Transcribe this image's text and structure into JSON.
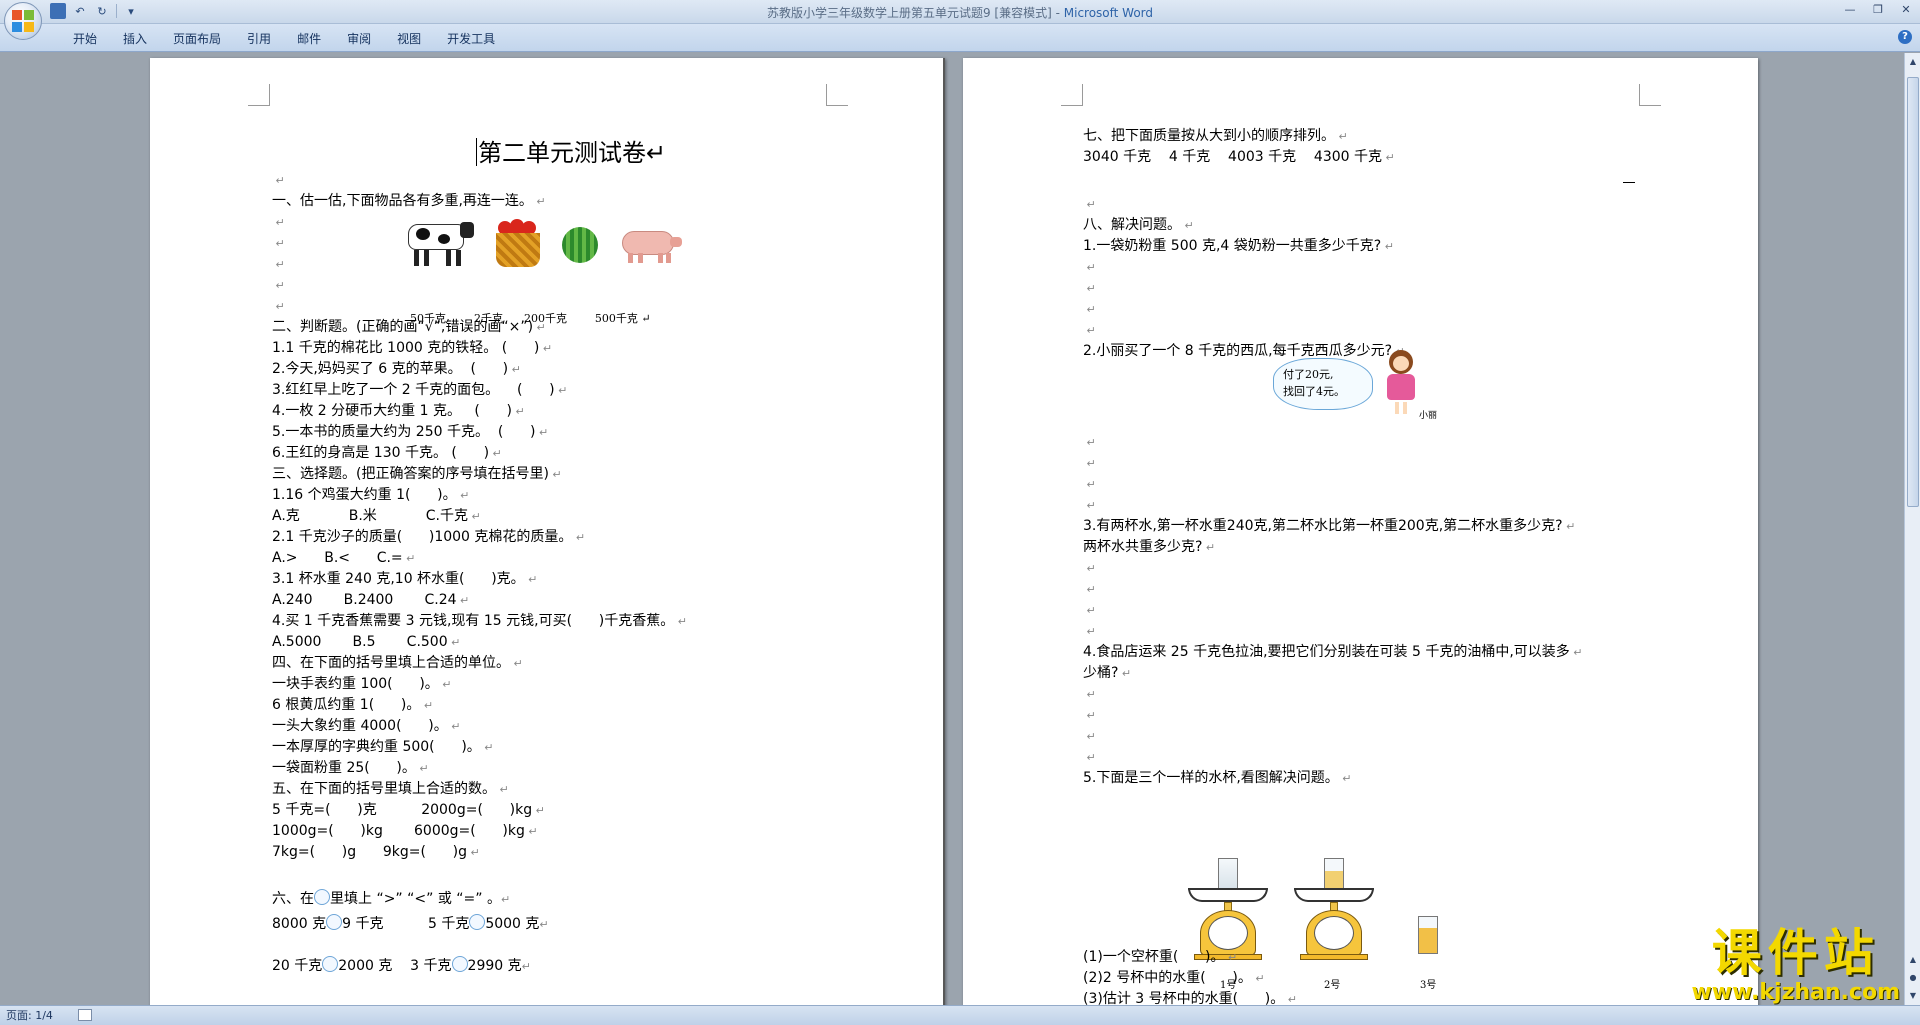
{
  "window": {
    "title": "苏教版小学三年级数学上册第五单元试题9 [兼容模式] - ",
    "app_name": "Microsoft Word"
  },
  "ribbon": {
    "tabs": [
      "开始",
      "插入",
      "页面布局",
      "引用",
      "邮件",
      "审阅",
      "视图",
      "开发工具"
    ]
  },
  "status": {
    "page": "页面: 1/4"
  },
  "left_page": {
    "title": "第二单元测试卷",
    "lines": [
      "",
      "一、估一估,下面物品各有多重,再连一连。",
      "",
      "",
      "",
      "",
      "",
      "二、判断题。(正确的画“√”,错误的画“×”)",
      "1.1 千克的棉花比 1000 克的铁轻。 (      )",
      "2.今天,妈妈买了 6 克的苹果。  (      )",
      "3.红红早上吃了一个 2 千克的面包。    (      )",
      "4.一枚 2 分硬币大约重 1 克。   (      )",
      "5.一本书的质量大约为 250 千克。  (      )",
      "6.王红的身高是 130 千克。 (      )",
      "三、选择题。(把正确答案的序号填在括号里)",
      "1.16 个鸡蛋大约重 1(      )。",
      "A.克           B.米           C.千克",
      "2.1 千克沙子的质量(      )1000 克棉花的质量。",
      "A.>      B.<      C.=",
      "3.1 杯水重 240 克,10 杯水重(      )克。",
      "A.240       B.2400       C.24",
      "4.买 1 千克香蕉需要 3 元钱,现有 15 元钱,可买(      )千克香蕉。",
      "A.5000       B.5       C.500",
      "四、在下面的括号里填上合适的单位。",
      "一块手表约重 100(      )。",
      "6 根黄瓜约重 1(      )。",
      "一头大象约重 4000(      )。",
      "一本厚厚的字典约重 500(      )。",
      "一袋面粉重 25(      )。",
      "五、在下面的括号里填上合适的数。",
      "5 千克=(      )克          2000g=(      )kg",
      "1000g=(      )kg       6000g=(      )kg",
      "7kg=(      )g      9kg=(      )g"
    ],
    "weights_line": "50千克        2千克      200千克        500千克",
    "sec6_title": "六、在",
    "sec6_title_rest": "里填上 “>” “<” 或 “=” 。",
    "sec6_row1_a": "8000 克",
    "sec6_row1_b": "9 千克",
    "sec6_row1_c": "5 千克",
    "sec6_row1_d": "5000 克",
    "sec6_row2_a": "20 千克",
    "sec6_row2_b": "2000 克",
    "sec6_row2_c": "3 千克",
    "sec6_row2_d": "2990 克"
  },
  "right_page": {
    "lines_top": [
      "七、把下面质量按从大到小的顺序排列。",
      "3040 千克    4 千克    4003 千克    4300 千克"
    ],
    "lines_mid": [
      "",
      "八、解决问题。",
      "1.一袋奶粉重 500 克,4 袋奶粉一共重多少千克?",
      "",
      "",
      "",
      "",
      "2.小丽买了一个 8 千克的西瓜,每千克西瓜多少元?"
    ],
    "speech_text": "付了20元,\n找回了4元。",
    "girl_name": "小丽",
    "lines_lower": [
      "",
      "",
      "",
      "",
      "3.有两杯水,第一杯水重240克,第二杯水比第一杯重200克,第二杯水重多少克?",
      "两杯水共重多少克?",
      "",
      "",
      "",
      "",
      "4.食品店运来 25 千克色拉油,要把它们分别装在可装 5 千克的油桶中,可以装多",
      "少桶?",
      "",
      "",
      "",
      "",
      "5.下面是三个一样的水杯,看图解决问题。"
    ],
    "scale_labels": [
      "1号",
      "2号",
      "3号"
    ],
    "lines_bottom": [
      "(1)一个空杯重(      )。",
      "(2)2 号杯中的水重(      )。",
      "(3)估计 3 号杯中的水重(      )。"
    ]
  },
  "watermark": {
    "big": "课件站",
    "small": "www.kjzhan.com"
  }
}
